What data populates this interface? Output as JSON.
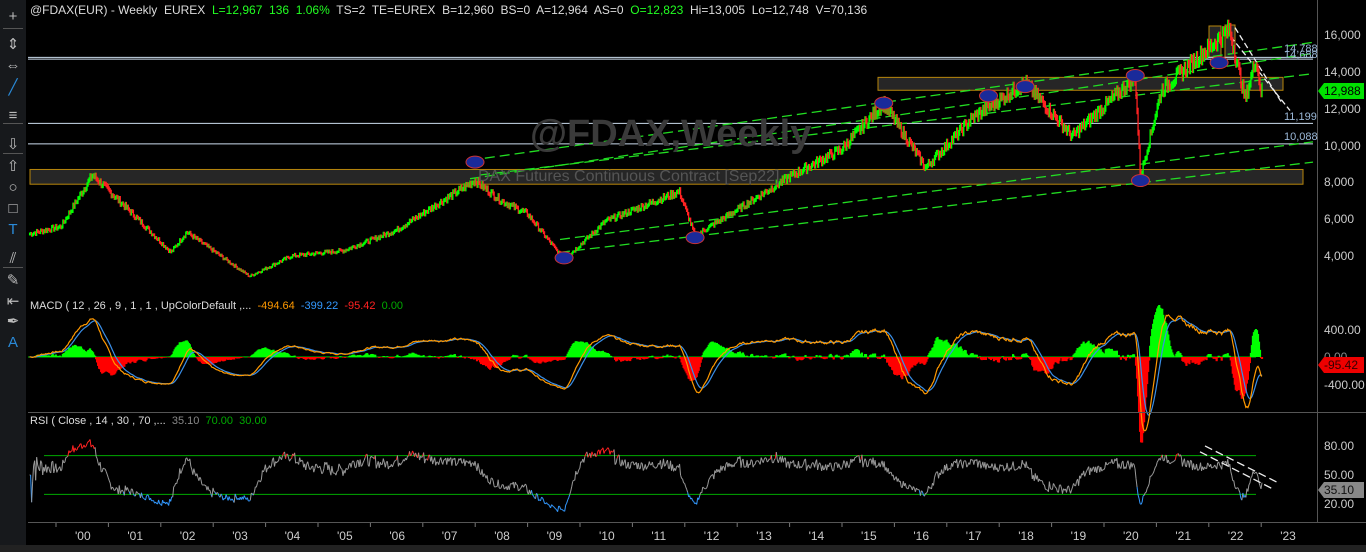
{
  "header": {
    "symbol": "@FDAX(EUR) - Weekly  EUREX",
    "last": "L=12,967",
    "change": "136",
    "pct": "1.06%",
    "ts": "TS=2",
    "te": "TE=EUREX",
    "bid": "B=12,960",
    "bs": "BS=0",
    "ask": "A=12,964",
    "as": "AS=0",
    "open": "O=12,823",
    "high": "Hi=13,005",
    "low": "Lo=12,748",
    "vol": "V=70,136"
  },
  "watermark": {
    "title": "@FDAX,Weekly",
    "subtitle": "DAX  Futures Continuous Contract [Sep22]"
  },
  "toolbar": [
    "crosshair-icon",
    "vertical-measure-icon",
    "horizontal-measure-icon",
    "trendline-icon",
    "horizontal-lines-icon",
    "arrow-down-icon",
    "arrow-up-icon",
    "ellipse-icon",
    "rectangle-icon",
    "text-icon",
    "parallel-lines-icon",
    "delete-drawings-icon",
    "jump-to-start-icon",
    "pen-icon",
    "text-style-icon"
  ],
  "price_axis": {
    "labels": [
      "16,000",
      "14,000",
      "12,000",
      "10,000",
      "8,000",
      "6,000",
      "4,000"
    ],
    "last": "12,988",
    "last_color": "#00e000"
  },
  "levels": [
    "14,788",
    "14,688",
    "11,199",
    "10,088"
  ],
  "macd": {
    "label": "MACD ( 12 , 26 , 9 , 1 , 1 , UpColorDefault ,...",
    "v1": "-494.64",
    "v2": "-399.22",
    "v3": "-95.42",
    "v4": "0.00",
    "axis": [
      "400.00",
      "0.00",
      "-400.00"
    ],
    "last": "-95.42"
  },
  "rsi": {
    "label": "RSI ( Close , 14 , 30 , 70 ,...",
    "v1": "35.10",
    "v2": "70.00",
    "v3": "30.00",
    "axis": [
      "80.00",
      "50.00",
      "20.00"
    ],
    "last": "35.10"
  },
  "x_axis": [
    "'00",
    "'01",
    "'02",
    "'03",
    "'04",
    "'05",
    "'06",
    "'07",
    "'08",
    "'09",
    "'10",
    "'11",
    "'12",
    "'13",
    "'14",
    "'15",
    "'16",
    "'17",
    "'18",
    "'19",
    "'20",
    "'21",
    "'22",
    "'23"
  ],
  "chart_data": {
    "type": "candlestick",
    "ylim": [
      3000,
      17000
    ],
    "anchors": [
      [
        1999.0,
        5200
      ],
      [
        1999.6,
        5600
      ],
      [
        2000.2,
        8400
      ],
      [
        2001.0,
        6200
      ],
      [
        2001.7,
        4200
      ],
      [
        2002.0,
        5300
      ],
      [
        2003.2,
        2900
      ],
      [
        2004.0,
        4000
      ],
      [
        2005.0,
        4300
      ],
      [
        2006.0,
        5400
      ],
      [
        2007.5,
        8100
      ],
      [
        2008.0,
        7000
      ],
      [
        2008.5,
        6300
      ],
      [
        2009.2,
        3800
      ],
      [
        2010.0,
        5900
      ],
      [
        2011.4,
        7500
      ],
      [
        2011.7,
        5100
      ],
      [
        2012.5,
        6500
      ],
      [
        2013.5,
        8300
      ],
      [
        2014.5,
        9800
      ],
      [
        2015.3,
        12300
      ],
      [
        2016.1,
        8800
      ],
      [
        2017.0,
        11500
      ],
      [
        2018.0,
        13400
      ],
      [
        2018.9,
        10500
      ],
      [
        2020.1,
        13700
      ],
      [
        2020.2,
        8300
      ],
      [
        2020.6,
        13000
      ],
      [
        2021.9,
        16300
      ],
      [
        2022.2,
        12500
      ],
      [
        2022.4,
        14700
      ],
      [
        2022.5,
        12967
      ]
    ]
  }
}
